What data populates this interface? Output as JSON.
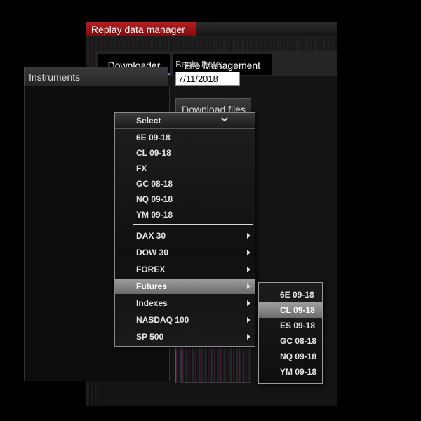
{
  "window": {
    "title": "Replay data manager"
  },
  "tabs": [
    {
      "label": "Downloader",
      "active": true
    },
    {
      "label": "File Management",
      "active": false
    }
  ],
  "instruments": {
    "header": "Instruments",
    "select_label": "Select",
    "recent": [
      "6E 09-18",
      "CL 09-18",
      "FX",
      "GC 08-18",
      "NQ 09-18",
      "YM 09-18"
    ],
    "categories": [
      {
        "label": "DAX 30",
        "highlighted": false
      },
      {
        "label": "DOW 30",
        "highlighted": false
      },
      {
        "label": "FOREX",
        "highlighted": false
      },
      {
        "label": "Futures",
        "highlighted": true
      },
      {
        "label": "Indexes",
        "highlighted": false
      },
      {
        "label": "NASDAQ 100",
        "highlighted": false
      },
      {
        "label": "SP 500",
        "highlighted": false
      }
    ],
    "futures_submenu": [
      {
        "label": "6E 09-18",
        "highlighted": false
      },
      {
        "label": "CL 09-18",
        "highlighted": true
      },
      {
        "label": "ES 09-18",
        "highlighted": false
      },
      {
        "label": "GC 08-18",
        "highlighted": false
      },
      {
        "label": "NQ 09-18",
        "highlighted": false
      },
      {
        "label": "YM 09-18",
        "highlighted": false
      }
    ]
  },
  "begin_date": {
    "label": "Begin Date:",
    "value": "7/11/2018"
  },
  "download": {
    "header": "Download files"
  },
  "colors": {
    "title_bar": "#a3151a",
    "tab_active_underline": "#2c8fd6",
    "highlight": "#8a8a8a"
  },
  "icons": {
    "search": "search-icon",
    "chevron": "chevron-down-icon",
    "submenu_arrow": "chevron-right-icon"
  }
}
